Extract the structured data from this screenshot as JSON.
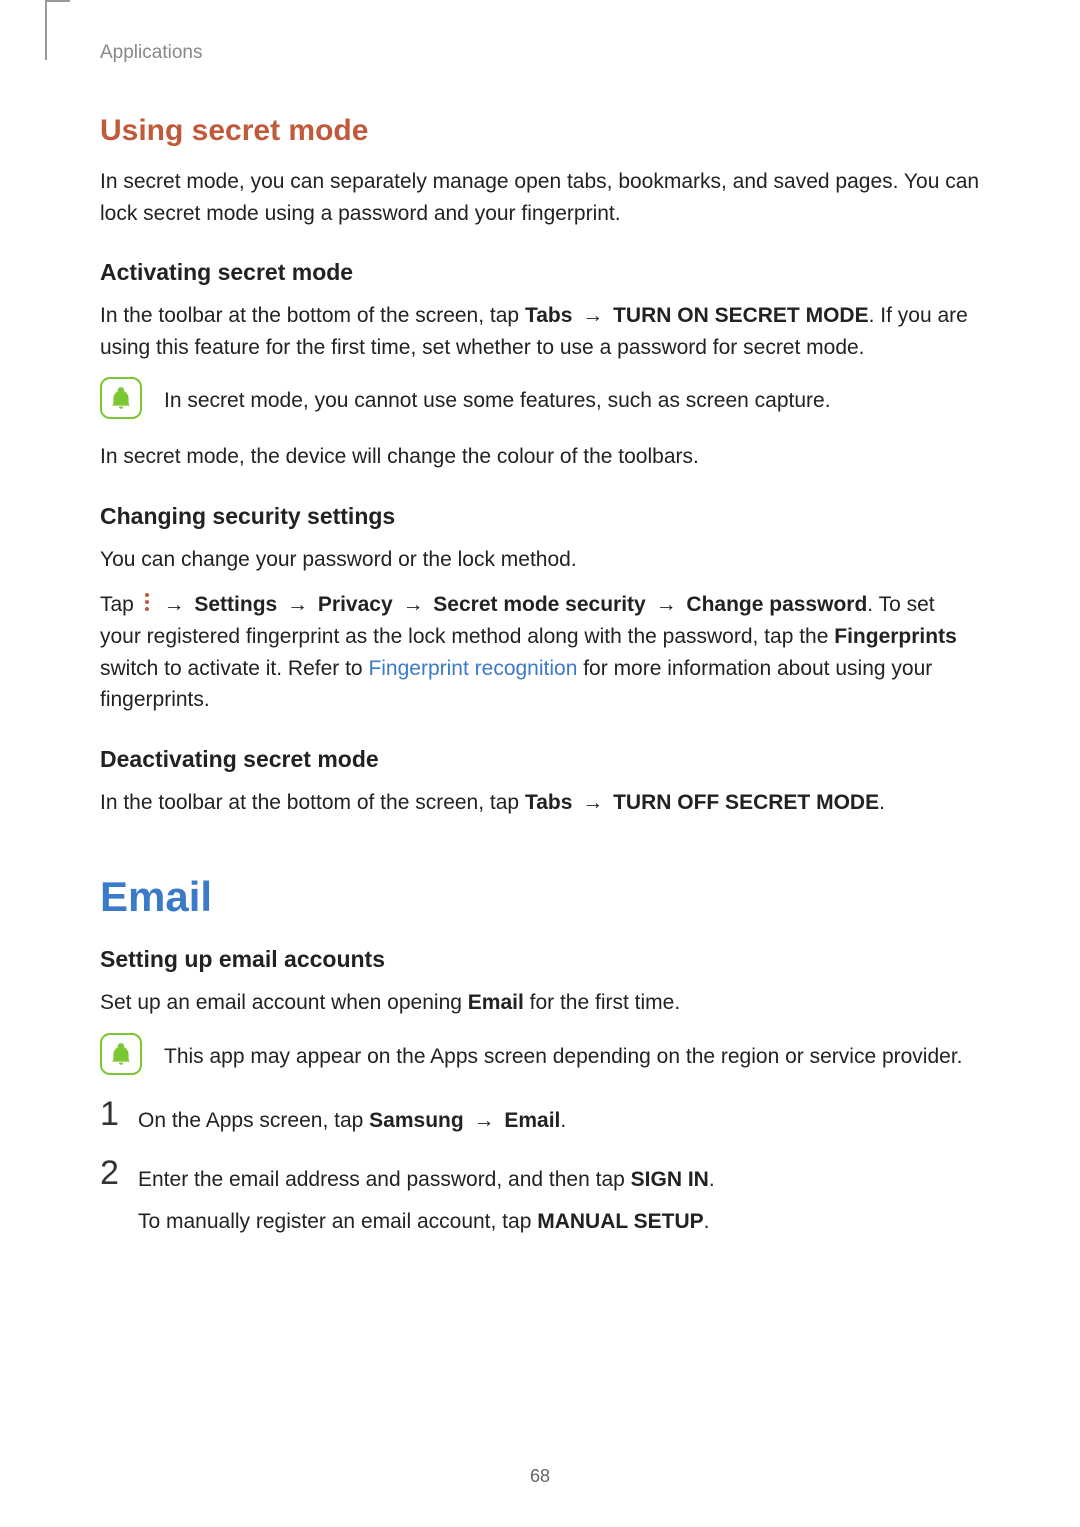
{
  "header": {
    "label": "Applications"
  },
  "section1": {
    "title": "Using secret mode",
    "intro": "In secret mode, you can separately manage open tabs, bookmarks, and saved pages. You can lock secret mode using a password and your fingerprint.",
    "activating": {
      "heading": "Activating secret mode",
      "text_pre": "In the toolbar at the bottom of the screen, tap ",
      "tabs": "Tabs",
      "arrow": " → ",
      "action": "TURN ON SECRET MODE",
      "text_post": ". If you are using this feature for the first time, set whether to use a password for secret mode.",
      "note": "In secret mode, you cannot use some features, such as screen capture.",
      "after_note": "In secret mode, the device will change the colour of the toolbars."
    },
    "changing": {
      "heading": "Changing security settings",
      "intro": "You can change your password or the lock method.",
      "tap": "Tap ",
      "arrow": " → ",
      "settings": "Settings",
      "privacy": "Privacy",
      "sms": "Secret mode security",
      "cp": "Change password",
      "post1": ". To set your registered fingerprint as the lock method along with the password, tap the ",
      "fp": "Fingerprints",
      "post2": " switch to activate it. Refer to ",
      "link": "Fingerprint recognition",
      "post3": " for more information about using your fingerprints."
    },
    "deactivating": {
      "heading": "Deactivating secret mode",
      "text_pre": "In the toolbar at the bottom of the screen, tap ",
      "tabs": "Tabs",
      "arrow": " → ",
      "action": "TURN OFF SECRET MODE",
      "text_post": "."
    }
  },
  "section2": {
    "title": "Email",
    "setup": {
      "heading": "Setting up email accounts",
      "intro_pre": "Set up an email account when opening ",
      "email_bold": "Email",
      "intro_post": " for the first time.",
      "note": "This app may appear on the Apps screen depending on the region or service provider."
    },
    "steps": {
      "s1": {
        "num": "1",
        "pre": "On the Apps screen, tap ",
        "samsung": "Samsung",
        "arrow": " → ",
        "email": "Email",
        "post": "."
      },
      "s2": {
        "num": "2",
        "line1_pre": "Enter the email address and password, and then tap ",
        "signin": "SIGN IN",
        "line1_post": ".",
        "line2_pre": "To manually register an email account, tap ",
        "manual": "MANUAL SETUP",
        "line2_post": "."
      }
    }
  },
  "pageNumber": "68"
}
